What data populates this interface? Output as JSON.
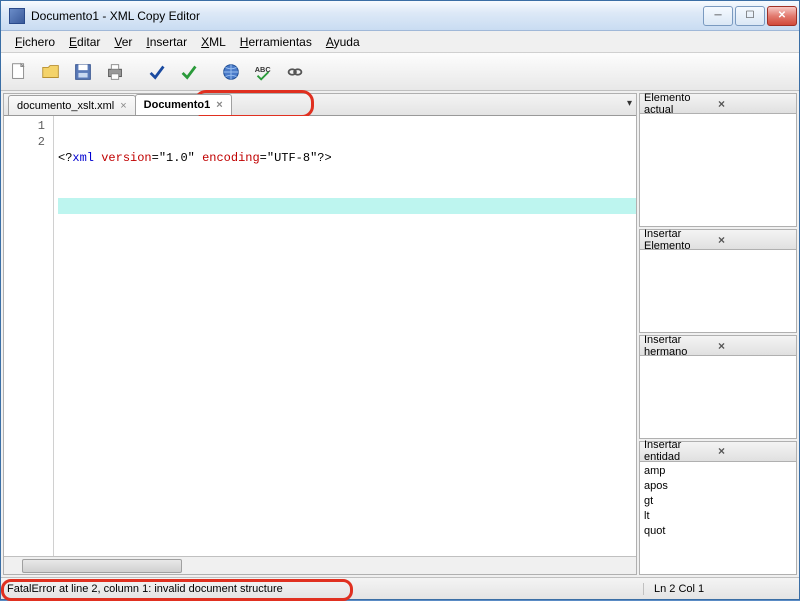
{
  "titlebar": {
    "title": "Documento1 - XML Copy Editor"
  },
  "menu": {
    "fichero": "Fichero",
    "editar": "Editar",
    "ver": "Ver",
    "insertar": "Insertar",
    "xml": "XML",
    "herramientas": "Herramientas",
    "ayuda": "Ayuda"
  },
  "tabs": [
    {
      "label": "documento_xslt.xml",
      "active": false
    },
    {
      "label": "Documento1",
      "active": true
    }
  ],
  "code": {
    "line_numbers": [
      "1",
      "2"
    ],
    "line1": {
      "open": "<?",
      "pi": "xml ",
      "attr1k": "version",
      "eq1": "=",
      "attr1v": "\"1.0\" ",
      "attr2k": "encoding",
      "eq2": "=",
      "attr2v": "\"UTF-8\"",
      "close": "?>"
    }
  },
  "panels": {
    "current": "Elemento actual",
    "insert_elem": "Insertar Elemento",
    "insert_sibling": "Insertar hermano",
    "insert_entity": "Insertar entidad",
    "entities": [
      "amp",
      "apos",
      "gt",
      "lt",
      "quot"
    ]
  },
  "status": {
    "error": "FatalError at line 2, column 1: invalid document structure",
    "position": "Ln 2 Col 1"
  }
}
